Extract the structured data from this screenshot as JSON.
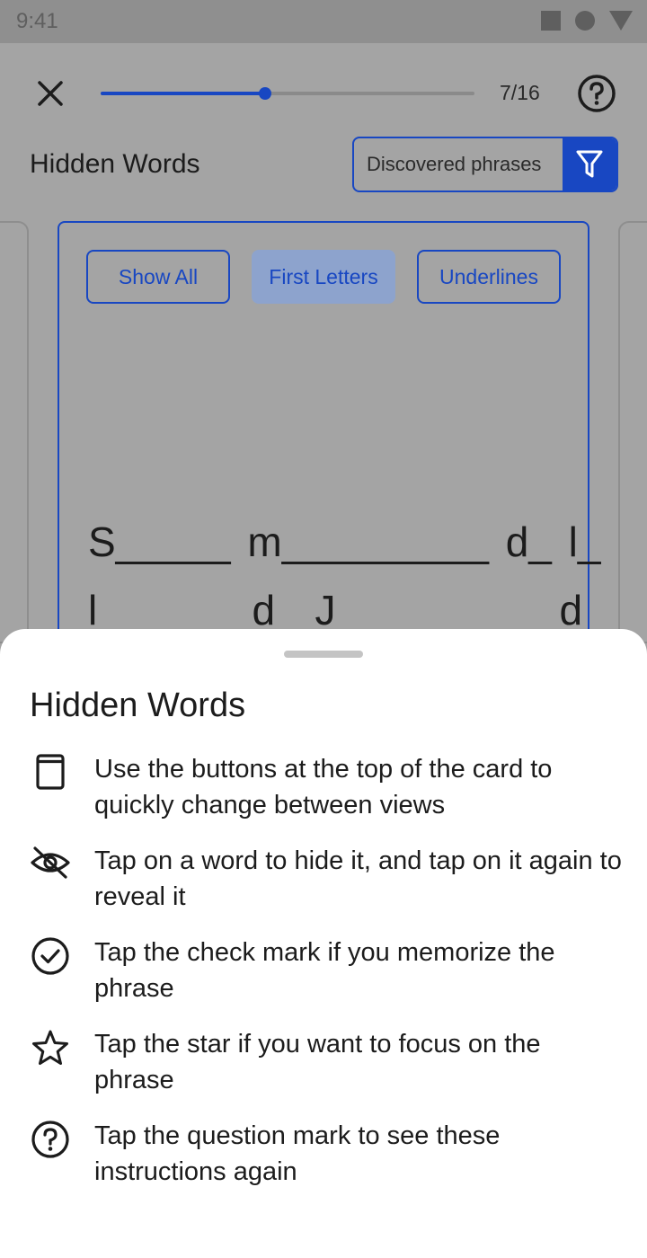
{
  "status_bar": {
    "time": "9:41"
  },
  "header": {
    "page_counter": "7/16",
    "progress_fraction": 0.44
  },
  "deck": {
    "title": "Hidden Words",
    "filter_label": "Discovered phrases"
  },
  "card": {
    "view_buttons": [
      "Show All",
      "First Letters",
      "Underlines"
    ],
    "active_view": "First Letters",
    "phrase_lines": [
      "S_____  m_________  d_  l_",
      "l______  d_  J_________  d_"
    ]
  },
  "sheet": {
    "title": "Hidden Words",
    "instructions": [
      {
        "icon": "card-icon",
        "text": "Use the buttons at the top of the card to quickly change between views"
      },
      {
        "icon": "eye-off-icon",
        "text": "Tap on a word to hide it, and tap on it again to reveal it"
      },
      {
        "icon": "check-circle-icon",
        "text": "Tap the check mark if you memorize the phrase"
      },
      {
        "icon": "star-icon",
        "text": "Tap the star if you want to focus on the phrase"
      },
      {
        "icon": "help-circle-icon",
        "text": "Tap the question mark to see these instructions again"
      }
    ]
  },
  "colors": {
    "accent": "#1847c2",
    "scrim": "#a4a4a4",
    "sheet": "#ffffff"
  }
}
